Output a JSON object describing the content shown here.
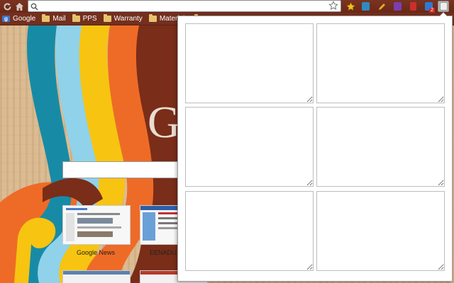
{
  "omnibox": {
    "value": "",
    "placeholder": ""
  },
  "toolbar": {
    "icons": [
      "reload-icon",
      "home-icon",
      "search-icon",
      "star-icon"
    ],
    "extensions": [
      {
        "name": "star-extension-icon",
        "color": "#f2c21b"
      },
      {
        "name": "book-extension-icon",
        "color": "#2f8bbf"
      },
      {
        "name": "pencil-extension-icon",
        "color": "#f0b030"
      },
      {
        "name": "purple-extension-icon",
        "color": "#7a3fb0"
      },
      {
        "name": "red-book-extension-icon",
        "color": "#c9302c"
      },
      {
        "name": "check-extension-icon",
        "color": "#2a7ad6",
        "badge": "2"
      },
      {
        "name": "notes-extension-icon",
        "color": "#e8e8e8"
      }
    ]
  },
  "bookmarks": [
    {
      "label": "Google",
      "icon": "google-icon"
    },
    {
      "label": "Mail",
      "icon": "folder-icon"
    },
    {
      "label": "PPS",
      "icon": "folder-icon"
    },
    {
      "label": "Warranty",
      "icon": "folder-icon"
    },
    {
      "label": "Materials",
      "icon": "folder-icon"
    }
  ],
  "ntp": {
    "logo_letter": "G",
    "search_value": "",
    "thumbnails": [
      {
        "label": "Google News"
      },
      {
        "label": "EENADU Online"
      }
    ]
  },
  "popup": {
    "notes": [
      "",
      "",
      "",
      "",
      "",
      ""
    ]
  },
  "colors": {
    "frame": "#742f1e",
    "teal": "#178ba6",
    "lightblue": "#8fd2ea",
    "yellow": "#f7c411",
    "orange": "#ee6b27",
    "brown": "#7a2d18"
  }
}
